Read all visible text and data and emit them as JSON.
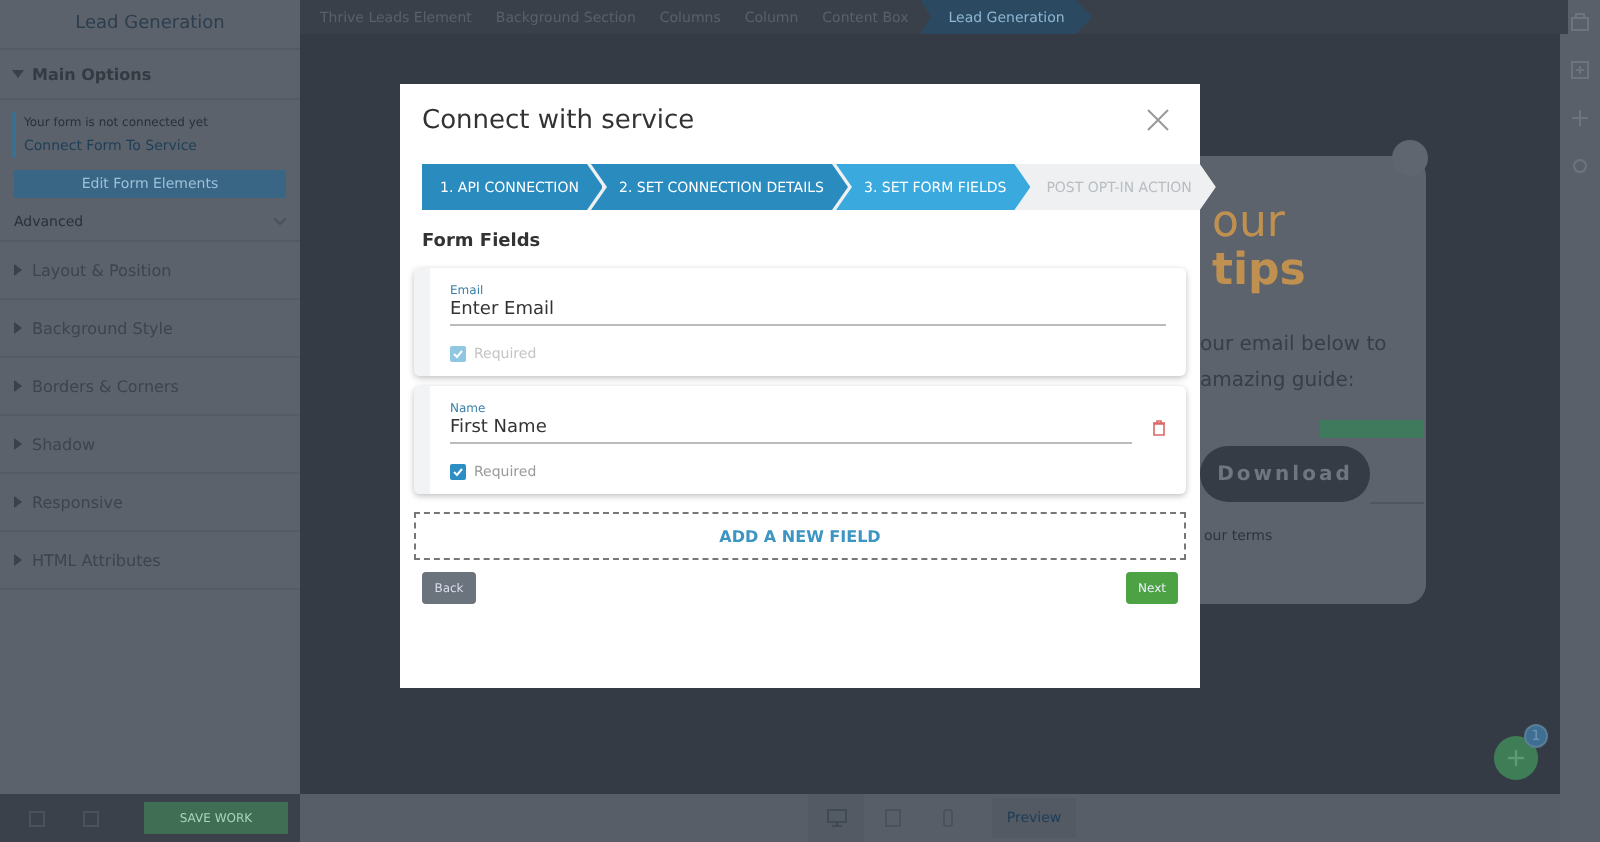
{
  "sidebar": {
    "title": "Lead Generation",
    "main_options": {
      "label": "Main Options",
      "expanded": true
    },
    "notice": "Your form is not connected yet",
    "connect_link": "Connect Form To Service",
    "edit_button": "Edit Form Elements",
    "advanced": "Advanced",
    "sections": [
      {
        "label": "Layout & Position"
      },
      {
        "label": "Background Style"
      },
      {
        "label": "Borders & Corners"
      },
      {
        "label": "Shadow"
      },
      {
        "label": "Responsive"
      },
      {
        "label": "HTML Attributes"
      }
    ]
  },
  "breadcrumbs": [
    {
      "label": "Thrive Leads Element",
      "selected": false
    },
    {
      "label": "Background Section",
      "selected": false
    },
    {
      "label": "Columns",
      "selected": false
    },
    {
      "label": "Column",
      "selected": false
    },
    {
      "label": "Content Box",
      "selected": false
    },
    {
      "label": "Lead Generation",
      "selected": true
    }
  ],
  "canvas": {
    "lines": [
      {
        "kind": "heading",
        "text": "our"
      },
      {
        "kind": "heading-bold",
        "text": "tips"
      },
      {
        "kind": "body",
        "text": "our email below to"
      },
      {
        "kind": "body",
        "text": "amazing guide:"
      }
    ],
    "button": "Download",
    "footnote": "our terms",
    "fab_badge": "1"
  },
  "bottom_bar": {
    "save": "SAVE WORK",
    "preview": "Preview"
  },
  "modal": {
    "title": "Connect with service",
    "steps": [
      {
        "label": "1. API CONNECTION",
        "completed": true,
        "selected": false
      },
      {
        "label": "2. SET CONNECTION DETAILS",
        "completed": true,
        "selected": false
      },
      {
        "label": "3. SET FORM FIELDS",
        "completed": false,
        "selected": true
      },
      {
        "label": "POST OPT-IN ACTION",
        "completed": false,
        "selected": false
      }
    ],
    "section_title": "Form Fields",
    "fields": [
      {
        "label": "Email",
        "value": "Enter Email",
        "required": {
          "label": "Required",
          "checked": true,
          "disabled": true
        },
        "deletable": false
      },
      {
        "label": "Name",
        "value": "First Name",
        "required": {
          "label": "Required",
          "checked": true,
          "disabled": false
        },
        "deletable": true
      }
    ],
    "add_field": "ADD A NEW FIELD",
    "back": "Back",
    "next": "Next"
  }
}
